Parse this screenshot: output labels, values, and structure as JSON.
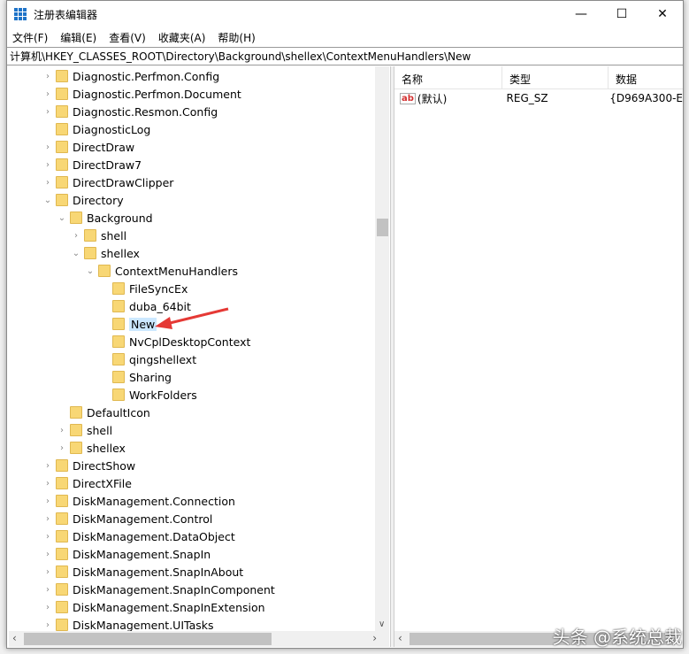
{
  "window": {
    "title": "注册表编辑器",
    "minimize": "—",
    "maximize": "☐",
    "close": "✕"
  },
  "menu": [
    "文件(F)",
    "编辑(E)",
    "查看(V)",
    "收藏夹(A)",
    "帮助(H)"
  ],
  "address": "计算机\\HKEY_CLASSES_ROOT\\Directory\\Background\\shellex\\ContextMenuHandlers\\New",
  "tree": [
    {
      "label": "Diagnostic.Perfmon.Config",
      "level": 0,
      "state": "collapsed"
    },
    {
      "label": "Diagnostic.Perfmon.Document",
      "level": 0,
      "state": "collapsed"
    },
    {
      "label": "Diagnostic.Resmon.Config",
      "level": 0,
      "state": "collapsed"
    },
    {
      "label": "DiagnosticLog",
      "level": 0,
      "state": "leaf"
    },
    {
      "label": "DirectDraw",
      "level": 0,
      "state": "collapsed"
    },
    {
      "label": "DirectDraw7",
      "level": 0,
      "state": "collapsed"
    },
    {
      "label": "DirectDrawClipper",
      "level": 0,
      "state": "collapsed"
    },
    {
      "label": "Directory",
      "level": 0,
      "state": "expanded"
    },
    {
      "label": "Background",
      "level": 1,
      "state": "expanded"
    },
    {
      "label": "shell",
      "level": 2,
      "state": "collapsed"
    },
    {
      "label": "shellex",
      "level": 2,
      "state": "expanded"
    },
    {
      "label": "ContextMenuHandlers",
      "level": 3,
      "state": "expanded"
    },
    {
      "label": "FileSyncEx",
      "level": 4,
      "state": "leaf"
    },
    {
      "label": "duba_64bit",
      "level": 4,
      "state": "leaf"
    },
    {
      "label": "New",
      "level": 4,
      "state": "leaf",
      "selected": true
    },
    {
      "label": "NvCplDesktopContext",
      "level": 4,
      "state": "leaf"
    },
    {
      "label": "qingshellext",
      "level": 4,
      "state": "leaf"
    },
    {
      "label": "Sharing",
      "level": 4,
      "state": "leaf"
    },
    {
      "label": "WorkFolders",
      "level": 4,
      "state": "leaf"
    },
    {
      "label": "DefaultIcon",
      "level": 1,
      "state": "leaf"
    },
    {
      "label": "shell",
      "level": 1,
      "state": "collapsed"
    },
    {
      "label": "shellex",
      "level": 1,
      "state": "collapsed"
    },
    {
      "label": "DirectShow",
      "level": 0,
      "state": "collapsed"
    },
    {
      "label": "DirectXFile",
      "level": 0,
      "state": "collapsed"
    },
    {
      "label": "DiskManagement.Connection",
      "level": 0,
      "state": "collapsed"
    },
    {
      "label": "DiskManagement.Control",
      "level": 0,
      "state": "collapsed"
    },
    {
      "label": "DiskManagement.DataObject",
      "level": 0,
      "state": "collapsed"
    },
    {
      "label": "DiskManagement.SnapIn",
      "level": 0,
      "state": "collapsed"
    },
    {
      "label": "DiskManagement.SnapInAbout",
      "level": 0,
      "state": "collapsed"
    },
    {
      "label": "DiskManagement.SnapInComponent",
      "level": 0,
      "state": "collapsed"
    },
    {
      "label": "DiskManagement.SnapInExtension",
      "level": 0,
      "state": "collapsed"
    },
    {
      "label": "DiskManagement.UITasks",
      "level": 0,
      "state": "collapsed"
    }
  ],
  "list": {
    "headers": [
      "名称",
      "类型",
      "数据"
    ],
    "rows": [
      {
        "icon": "ab",
        "name": "(默认)",
        "type": "REG_SZ",
        "data": "{D969A300-E"
      }
    ]
  },
  "watermark": "头条 @系统总裁",
  "accent": "#e53935"
}
